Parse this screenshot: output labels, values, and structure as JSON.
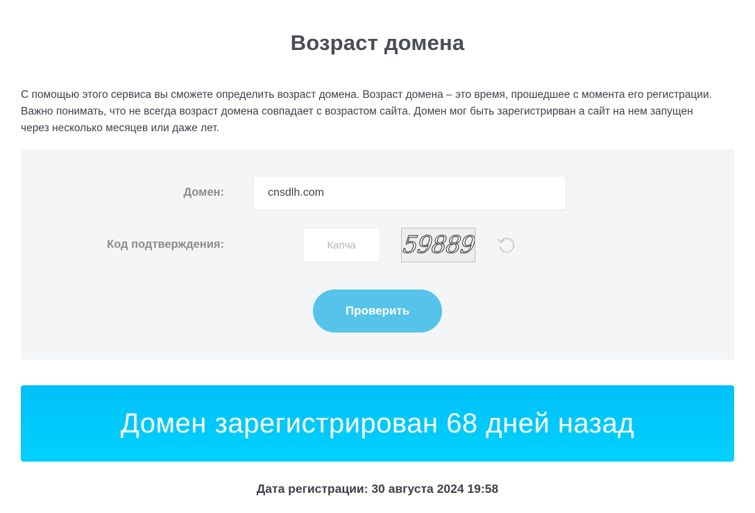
{
  "page": {
    "title": "Возраст домена",
    "intro": "С помощью этого сервиса вы сможете определить возраст домена. Возраст домена – это время, прошедшее с момента его регистрации. Важно понимать, что не всегда возраст домена совпадает с возрастом сайта. Домен мог быть зарегистрирван а сайт на нем запущен через несколько месяцев или даже лет."
  },
  "form": {
    "domain_label": "Домен:",
    "domain_value": "cnsdlh.com",
    "captcha_label": "Код подтверждения:",
    "captcha_placeholder": "Капча",
    "captcha_image_text": "59889",
    "refresh_icon": "refresh-icon",
    "submit_label": "Проверить"
  },
  "result": {
    "banner_text": "Домен зарегистрирован 68 дней назад",
    "registration_date": "Дата регистрации: 30 августа 2024 19:58"
  },
  "colors": {
    "form_background": "#f3f5f6",
    "button": "#55c3ea",
    "banner_top": "#00c0f9",
    "banner_bottom": "#00d1fc"
  }
}
